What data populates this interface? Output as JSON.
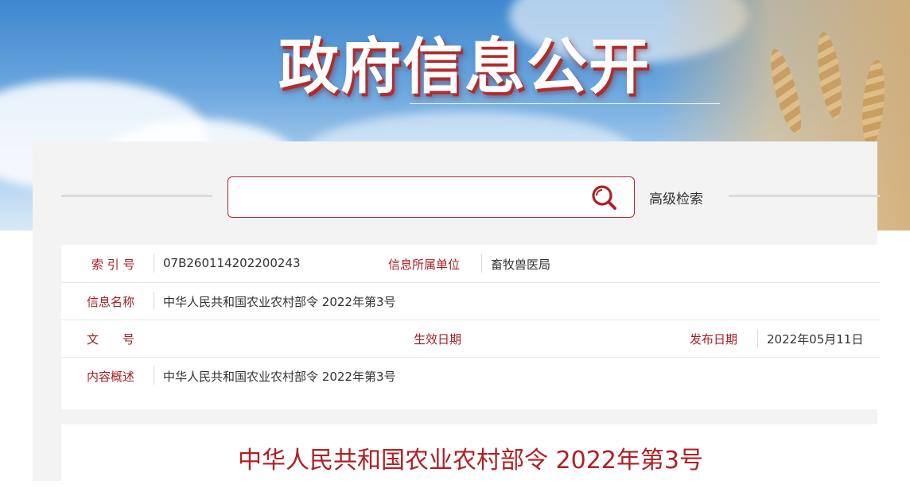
{
  "banner": {
    "title": "政府信息公开"
  },
  "search": {
    "input_value": "",
    "advanced_label": "高级检索"
  },
  "info": {
    "index_no_label": "索 引 号",
    "index_no_value": "07B260114202200243",
    "org_label": "信息所属单位",
    "org_value": "畜牧兽医局",
    "name_label": "信息名称",
    "name_value": "中华人民共和国农业农村部令 2022年第3号",
    "doc_no_label": "文　　号",
    "doc_no_value": "",
    "effective_label": "生效日期",
    "effective_value": "",
    "publish_label": "发布日期",
    "publish_value": "2022年05月11日",
    "summary_label": "内容概述",
    "summary_value": "中华人民共和国农业农村部令 2022年第3号"
  },
  "document": {
    "title": "中华人民共和国农业农村部令 2022年第3号"
  },
  "colors": {
    "accent": "#b01f24",
    "label": "#a71d23",
    "panel_bg": "#f3f3f3"
  }
}
